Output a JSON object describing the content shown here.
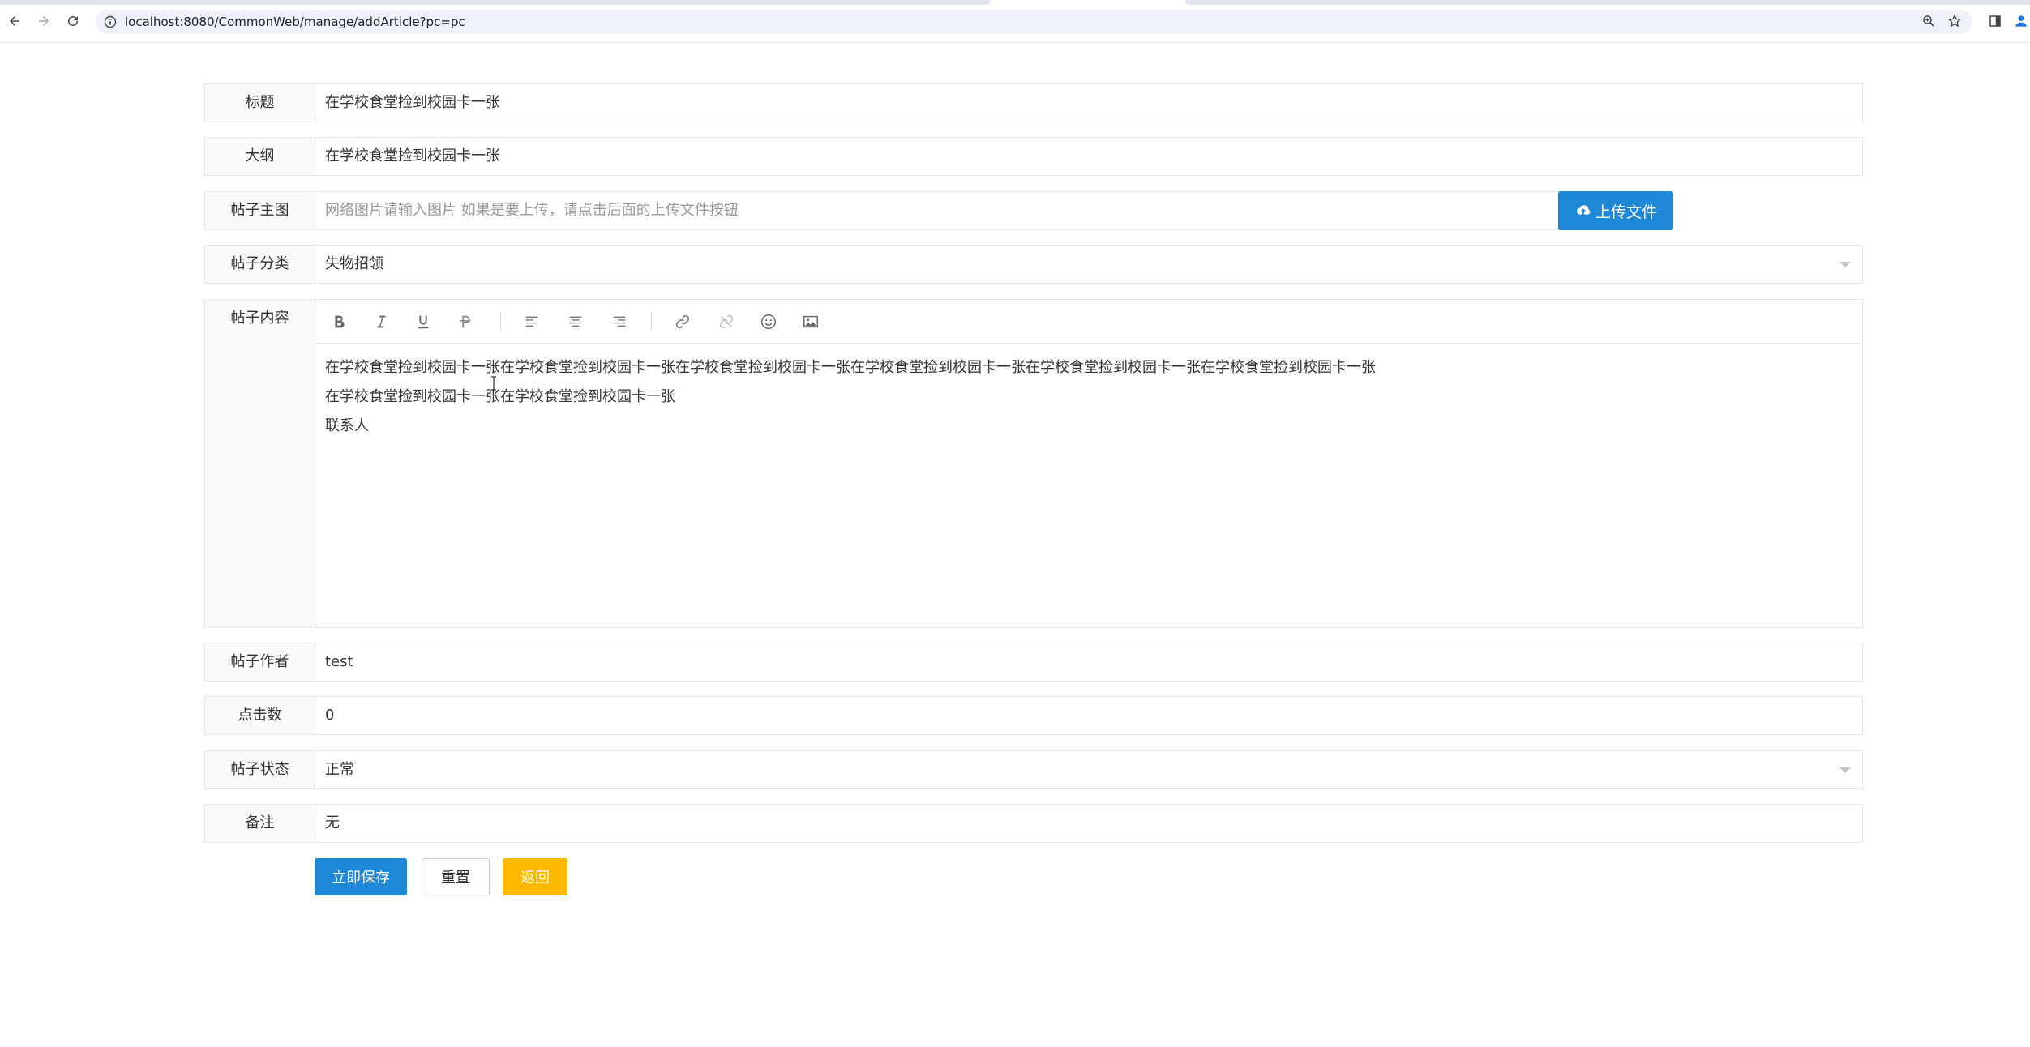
{
  "browser": {
    "url": "localhost:8080/CommonWeb/manage/addArticle?pc=pc",
    "icons": [
      "back-icon",
      "forward-icon",
      "reload-icon",
      "site-info-icon",
      "zoom-icon",
      "star-icon",
      "side-panel-icon",
      "profile-icon"
    ]
  },
  "form": {
    "title": {
      "label": "标题",
      "value": "在学校食堂捡到校园卡一张"
    },
    "outline": {
      "label": "大纲",
      "value": "在学校食堂捡到校园卡一张"
    },
    "cover": {
      "label": "帖子主图",
      "placeholder": "网络图片请输入图片 如果是要上传，请点击后面的上传文件按钮",
      "upload_label": "上传文件"
    },
    "category": {
      "label": "帖子分类",
      "value": "失物招领"
    },
    "content": {
      "label": "帖子内容",
      "lines": [
        "在学校食堂捡到校园卡一张在学校食堂捡到校园卡一张在学校食堂捡到校园卡一张在学校食堂捡到校园卡一张在学校食堂捡到校园卡一张在学校食堂捡到校园卡一张",
        "在学校食堂捡到校园卡一张在学校食堂捡到校园卡一张",
        "联系人"
      ],
      "toolbar": [
        "bold-icon",
        "italic-icon",
        "underline-icon",
        "strikethrough-icon",
        "align-left-icon",
        "align-center-icon",
        "align-right-icon",
        "link-icon",
        "unlink-icon",
        "emoji-icon",
        "image-icon"
      ]
    },
    "author": {
      "label": "帖子作者",
      "value": "test"
    },
    "clicks": {
      "label": "点击数",
      "value": "0"
    },
    "status": {
      "label": "帖子状态",
      "value": "正常"
    },
    "remark": {
      "label": "备注",
      "value": "无"
    }
  },
  "actions": {
    "save_label": "立即保存",
    "reset_label": "重置",
    "back_label": "返回"
  },
  "colors": {
    "primary": "#1e88d6",
    "warning": "#ffb800",
    "border": "#e6e6e6",
    "label_bg": "#fafafa"
  }
}
